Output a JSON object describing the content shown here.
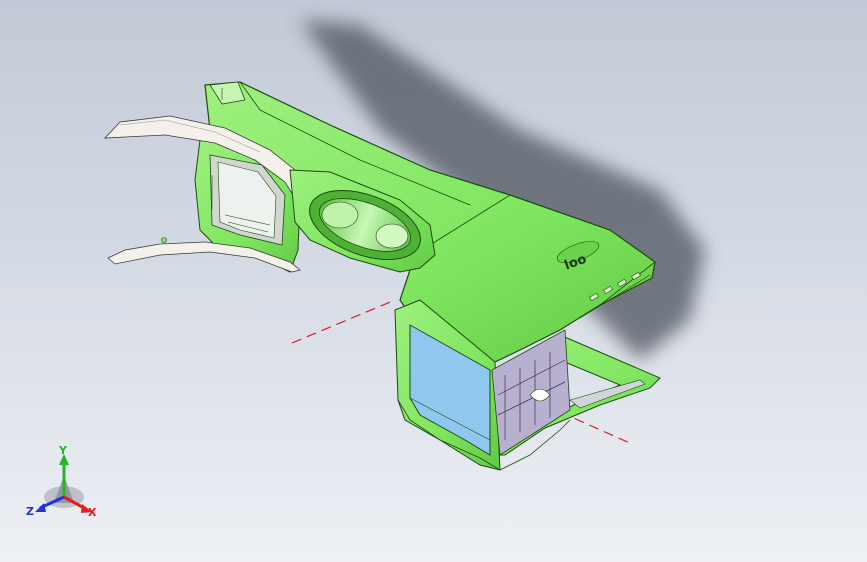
{
  "viewport": {
    "background_top": "#c2cad7",
    "background_bottom": "#eef0f5"
  },
  "model": {
    "body_color": "#7fe65f",
    "edge_color": "#1f4a12",
    "trim_color": "#f4f1ea",
    "interior_color": "#8fc7ee",
    "rib_color": "#b7b0cf",
    "shadow_color": "#4f555e",
    "ref_line_color": "#d42020",
    "logo_text": "loo"
  },
  "triad": {
    "x_label": "X",
    "y_label": "Y",
    "z_label": "Z",
    "x_color": "#e81a1a",
    "y_color": "#27b327",
    "z_color": "#2233d9"
  }
}
